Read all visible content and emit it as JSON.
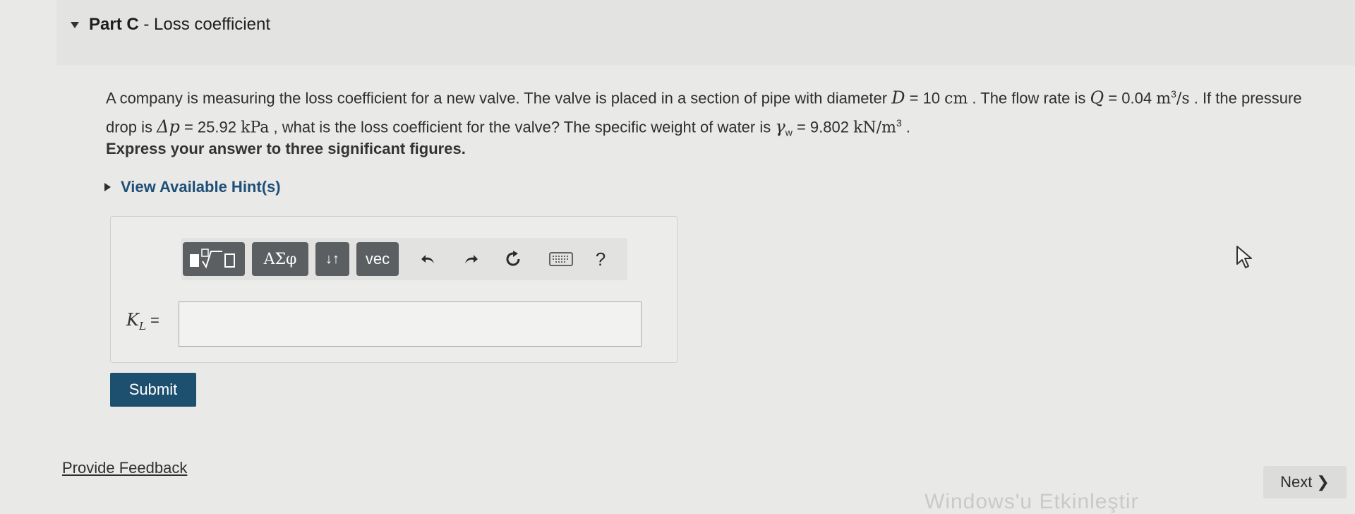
{
  "part": {
    "label": "Part C",
    "separator": " - ",
    "title": "Loss coefficient"
  },
  "question": {
    "t1": "A company is measuring the loss coefficient for a new valve. The valve is placed in a section of pipe with diameter ",
    "D_var": "D",
    "D_eq": " = 10 ",
    "D_unit": "cm",
    "t2": " . The flow rate is ",
    "Q_var": "Q",
    "Q_eq": " = 0.04 ",
    "Q_unit": "m",
    "Q_exp": "3",
    "Q_per": "/s",
    "t3": " . If the pressure drop is ",
    "dp_var": "Δp",
    "dp_eq": " = 25.92 ",
    "dp_unit": "kPa",
    "t4": " , what is the loss coefficient for the valve? The specific weight of water is ",
    "gw_var": "γ",
    "gw_sub": "w",
    "gw_eq": " = 9.802 ",
    "gw_unit": "kN/m",
    "gw_exp": "3",
    "t5": " ."
  },
  "instruction": "Express your answer to three significant figures.",
  "hint_label": "View Available Hint(s)",
  "toolbar": {
    "greek_label": "ΑΣφ",
    "subsup_label": "↓↑",
    "vec_label": "vec",
    "help_label": "?"
  },
  "answer": {
    "var": "K",
    "sub": "L",
    "eq": " =",
    "value": ""
  },
  "submit_label": "Submit",
  "feedback_label": "Provide Feedback",
  "next_label": "Next",
  "next_glyph": "❯",
  "watermark": "Windows'u Etkinleştir"
}
